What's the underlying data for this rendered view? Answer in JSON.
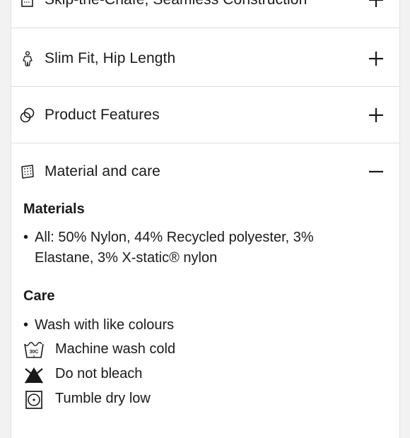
{
  "accordion": {
    "items": [
      {
        "label": "Skip-the-Chafe, Seamless Construction",
        "icon": "seam-icon",
        "expanded": false
      },
      {
        "label": "Slim Fit, Hip Length",
        "icon": "fit-figure-icon",
        "expanded": false
      },
      {
        "label": "Product Features",
        "icon": "features-icon",
        "expanded": false
      },
      {
        "label": "Material and care",
        "icon": "fabric-icon",
        "expanded": true
      }
    ]
  },
  "material_care": {
    "materials_heading": "Materials",
    "materials": [
      {
        "line1": "All: 50% Nylon, 44% Recycled polyester, 3%",
        "line2": "Elastane, 3% X-static® nylon"
      }
    ],
    "care_heading": "Care",
    "care_bullet": "Wash with like colours",
    "care_items": [
      {
        "label": "Machine wash cold",
        "icon": "wash-30c-icon",
        "icon_text": "30C"
      },
      {
        "label": "Do not bleach",
        "icon": "no-bleach-icon"
      },
      {
        "label": "Tumble dry low",
        "icon": "tumble-dry-low-icon"
      }
    ]
  }
}
